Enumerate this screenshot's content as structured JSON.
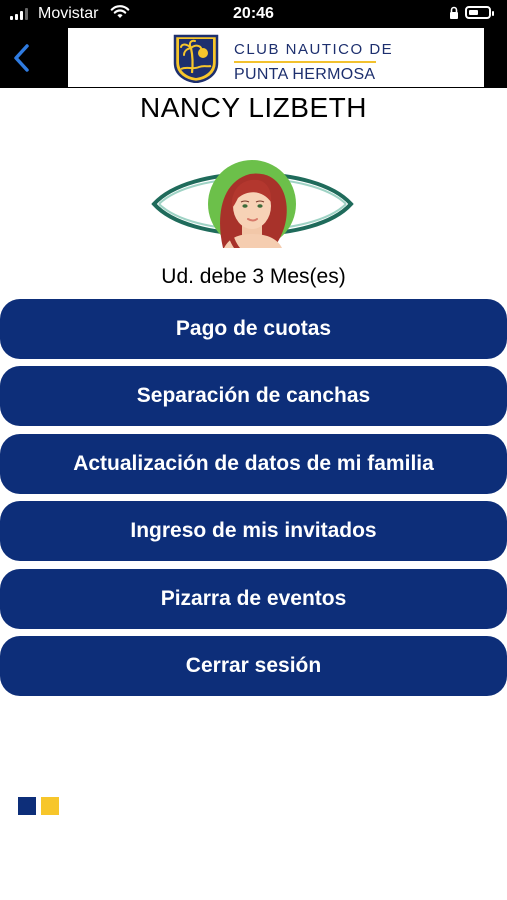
{
  "status_bar": {
    "carrier": "Movistar",
    "time": "20:46"
  },
  "header": {
    "logo_line1": "CLUB NAUTICO DE",
    "logo_line2": "PUNTA HERMOSA"
  },
  "profile": {
    "name": "NANCY LIZBETH",
    "debt_message": "Ud. debe 3 Mes(es)"
  },
  "menu": {
    "items": [
      {
        "label": "Pago de cuotas"
      },
      {
        "label": "Separación de canchas"
      },
      {
        "label": "Actualización de datos de mi familia"
      },
      {
        "label": "Ingreso de mis invitados"
      },
      {
        "label": "Pizarra de eventos"
      },
      {
        "label": "Cerrar sesión"
      }
    ]
  },
  "colors": {
    "primary": "#0d2e79",
    "accent": "#f7c62b",
    "avatar_bg": "#6cc04a",
    "eye_outline": "#1f6b5b"
  },
  "icons": {
    "back": "chevron-left-icon",
    "signal": "cellular-signal-icon",
    "wifi": "wifi-icon",
    "orientation_lock": "orientation-lock-icon",
    "battery": "battery-icon",
    "logo": "palm-tree-emblem-icon"
  }
}
